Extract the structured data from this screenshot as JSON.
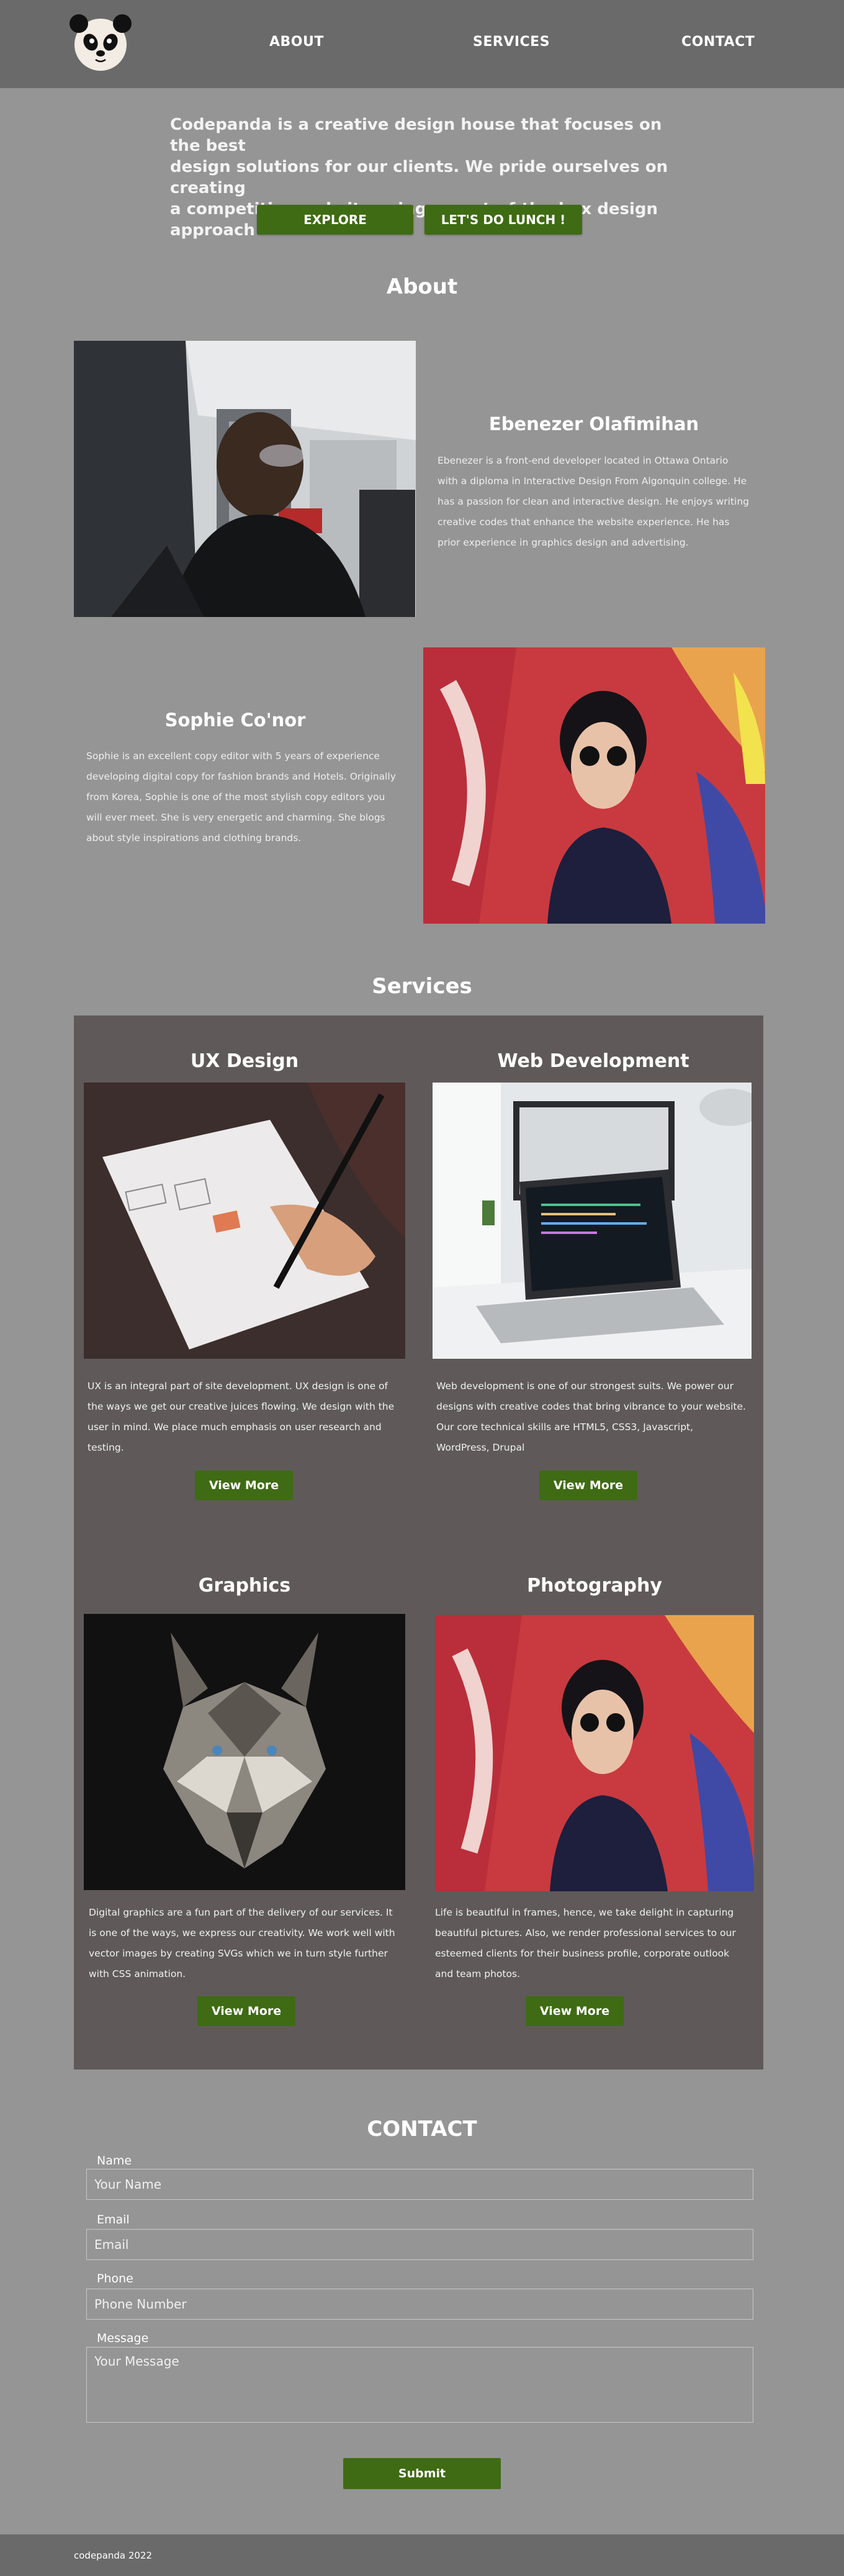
{
  "nav": {
    "logo_alt": "panda-logo",
    "items": [
      {
        "label": "ABOUT"
      },
      {
        "label": "SERVICES"
      },
      {
        "label": "CONTACT"
      }
    ]
  },
  "hero": {
    "line1": "Codepanda is a creative design house that focuses on the best",
    "line2": "design solutions for our clients. We pride ourselves on creating",
    "line3": "a competitive website using an out-of-the-box design approach",
    "explore_label": "EXPLORE",
    "lunch_label": "LET'S DO LUNCH !"
  },
  "about": {
    "title": "About",
    "people": [
      {
        "name": "Ebenezer Olafimihan",
        "bio": [
          "Ebenezer is a front-end developer located in Ottawa Ontario",
          "with a diploma in Interactive Design From Algonquin college. He",
          "has a passion for clean and interactive design. He enjoys writing",
          "creative codes that enhance the website experience. He has",
          "prior experience in graphics design and advertising."
        ]
      },
      {
        "name": "Sophie Co'nor",
        "bio": [
          "Sophie is an excellent copy editor with 5 years of experience",
          "developing digital copy for fashion brands and Hotels. Originally",
          "from Korea, Sophie is one of the most stylish copy editors you",
          "will ever meet. She is very energetic and charming. She blogs",
          "about style inspirations and clothing brands."
        ]
      }
    ]
  },
  "services": {
    "title": "Services",
    "items": [
      {
        "title": "UX Design",
        "text": [
          "UX is an integral part of site development. UX design is one of",
          "the ways we get our creative juices flowing. We design with the",
          "user in mind. We place much emphasis on user research and",
          "testing."
        ],
        "button": "View More"
      },
      {
        "title": "Web Development",
        "text": [
          "Web development is one of our strongest suits. We power our",
          "designs with creative codes that bring vibrance to your website.",
          "Our core technical skills are HTML5, CSS3, Javascript,",
          "WordPress, Drupal"
        ],
        "button": "View More"
      },
      {
        "title": "Graphics",
        "text": [
          "Digital graphics are a fun part of the delivery of our services. It",
          "is one of the ways, we express our creativity. We work well with",
          "vector images by creating SVGs which we in turn style further",
          "with CSS animation."
        ],
        "button": "View More"
      },
      {
        "title": "Photography",
        "text": [
          "Life is beautiful in frames, hence, we take delight in capturing",
          "beautiful pictures. Also, we render professional services to our",
          "esteemed clients for their business profile, corporate outlook",
          "and team photos."
        ],
        "button": "View More"
      }
    ]
  },
  "contact": {
    "title": "CONTACT",
    "fields": [
      {
        "label": "Name",
        "placeholder": "Your Name"
      },
      {
        "label": "Email",
        "placeholder": "Email"
      },
      {
        "label": "Phone",
        "placeholder": "Phone Number"
      },
      {
        "label": "Message",
        "placeholder": "Your Message"
      }
    ],
    "submit_label": "Submit"
  },
  "footer": {
    "text": "codepanda 2022"
  },
  "colors": {
    "page_bg": "#959595",
    "header_bg": "#6a6a6a",
    "button_green": "#3f6b14",
    "services_panel": "#5f5a59"
  }
}
